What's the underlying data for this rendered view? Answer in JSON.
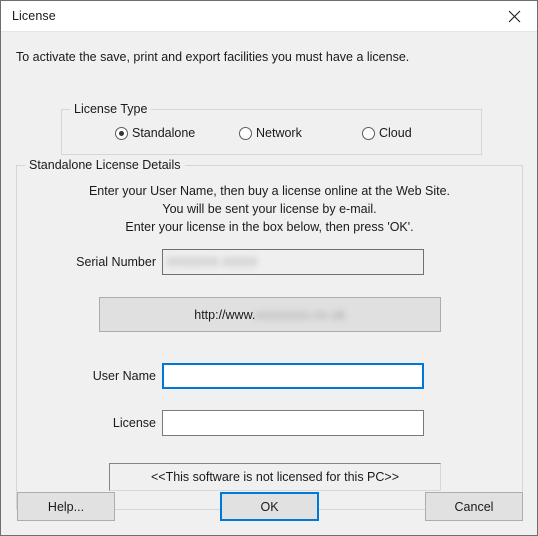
{
  "window": {
    "title": "License",
    "close_icon": "close-icon"
  },
  "intro_text": "To activate the save, print and export facilities you must have a license.",
  "license_type": {
    "legend": "License Type",
    "options": [
      {
        "label": "Standalone",
        "selected": true
      },
      {
        "label": "Network",
        "selected": false
      },
      {
        "label": "Cloud",
        "selected": false
      }
    ]
  },
  "standalone_details": {
    "legend": "Standalone License Details",
    "instructions": [
      "Enter your User Name, then buy a license online at the Web Site.",
      "You will be sent your license by e-mail.",
      "Enter your license in the box below, then press 'OK'."
    ],
    "serial_number": {
      "label": "Serial Number",
      "value": "XXXXXX-XXXX",
      "redacted": true,
      "readonly": true
    },
    "website_button": {
      "visible_text": "http://www.",
      "redacted_text": "xxxxxxxx.co.uk"
    },
    "user_name": {
      "label": "User Name",
      "value": "",
      "placeholder": "",
      "focused": true
    },
    "license": {
      "label": "License",
      "value": "",
      "placeholder": ""
    },
    "status_text": "<<This software is not licensed for this PC>>"
  },
  "footer": {
    "help_label": "Help...",
    "ok_label": "OK",
    "cancel_label": "Cancel"
  },
  "colors": {
    "accent": "#0078d7",
    "dialog_background": "#f0f0f0",
    "titlebar_background": "#ffffff",
    "button_face": "#e1e1e1"
  }
}
